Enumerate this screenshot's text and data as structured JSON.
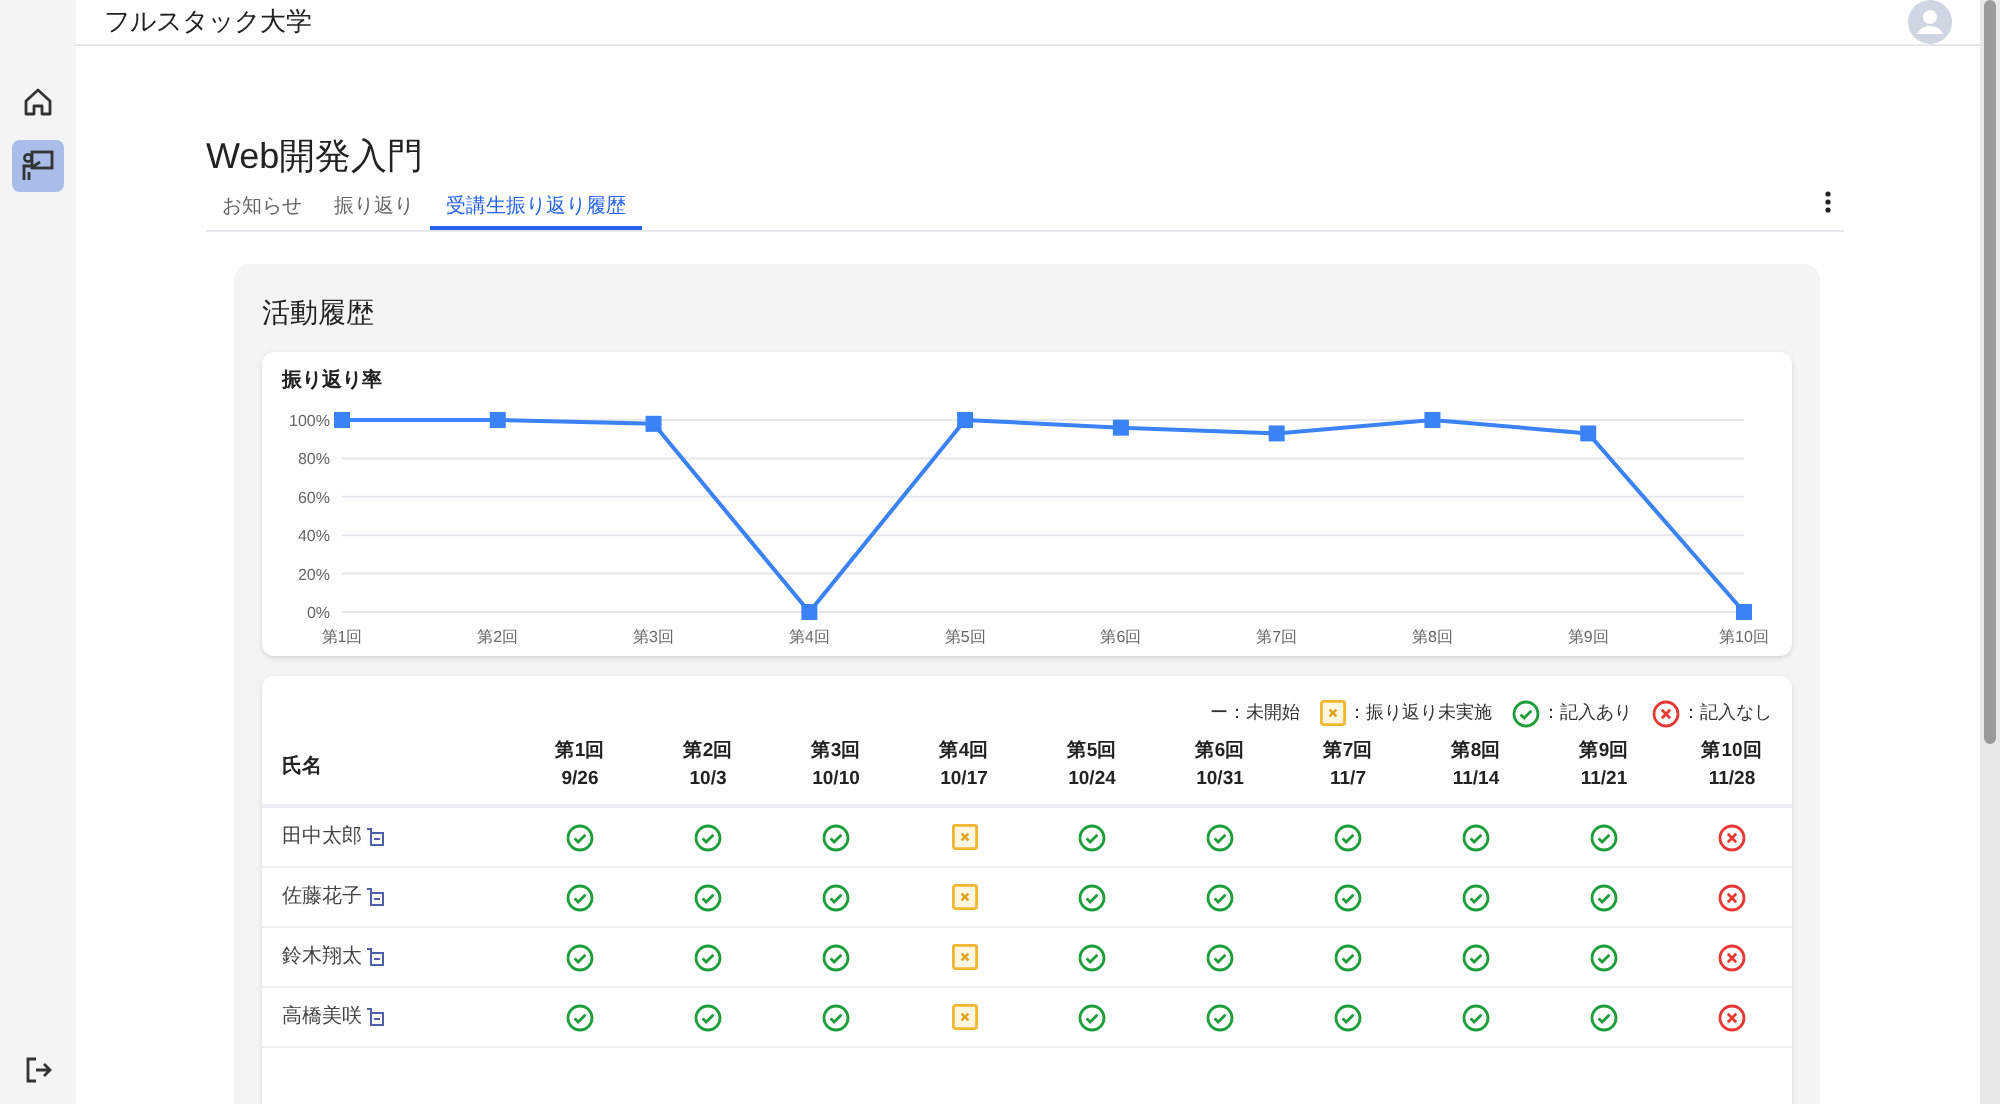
{
  "app": {
    "title": "フルスタック大学"
  },
  "sidebar": {
    "items": [
      {
        "kind": "home",
        "selected": false
      },
      {
        "kind": "teacher",
        "selected": true
      }
    ]
  },
  "course": {
    "title": "Web開発入門"
  },
  "tabs": [
    {
      "label": "お知らせ",
      "selected": false
    },
    {
      "label": "振り返り",
      "selected": false
    },
    {
      "label": "受講生振り返り履歴",
      "selected": true
    }
  ],
  "activity": {
    "title": "活動履歴",
    "chart": {
      "chart_data": {
        "type": "line",
        "title": "振り返り率",
        "grid": true,
        "categories": [
          "第1回",
          "第2回",
          "第3回",
          "第4回",
          "第5回",
          "第6回",
          "第7回",
          "第8回",
          "第9回",
          "第10回"
        ],
        "series": [
          {
            "color": "#3b82f6",
            "marker": "square",
            "values": [
              100,
              100,
              98,
              0,
              100,
              96,
              93,
              100,
              93,
              0
            ]
          }
        ],
        "ylim": [
          0,
          100
        ],
        "yticks": [
          {
            "value": 0,
            "label": "0%"
          },
          {
            "value": 20,
            "label": "20%"
          },
          {
            "value": 40,
            "label": "40%"
          },
          {
            "value": 60,
            "label": "60%"
          },
          {
            "value": 80,
            "label": "80%"
          },
          {
            "value": 100,
            "label": "100%"
          }
        ]
      }
    },
    "legend": [
      {
        "kind": "not_started",
        "label": "ー：未開始"
      },
      {
        "kind": "pending",
        "label": "：振り返り未実施"
      },
      {
        "kind": "done",
        "label": "：記入あり"
      },
      {
        "kind": "missing",
        "label": "：記入なし"
      }
    ],
    "table": {
      "name_header": "氏名",
      "columns": [
        {
          "round": "第1回",
          "date": "9/26"
        },
        {
          "round": "第2回",
          "date": "10/3"
        },
        {
          "round": "第3回",
          "date": "10/10"
        },
        {
          "round": "第4回",
          "date": "10/17"
        },
        {
          "round": "第5回",
          "date": "10/24"
        },
        {
          "round": "第6回",
          "date": "10/31"
        },
        {
          "round": "第7回",
          "date": "11/7"
        },
        {
          "round": "第8回",
          "date": "11/14"
        },
        {
          "round": "第9回",
          "date": "11/21"
        },
        {
          "round": "第10回",
          "date": "11/28"
        }
      ],
      "rows": [
        {
          "name": "田中太郎",
          "cells": [
            {
              "kind": "done"
            },
            {
              "kind": "done"
            },
            {
              "kind": "done"
            },
            {
              "kind": "pending"
            },
            {
              "kind": "done"
            },
            {
              "kind": "done"
            },
            {
              "kind": "done"
            },
            {
              "kind": "done"
            },
            {
              "kind": "done"
            },
            {
              "kind": "missing"
            }
          ]
        },
        {
          "name": "佐藤花子",
          "cells": [
            {
              "kind": "done"
            },
            {
              "kind": "done"
            },
            {
              "kind": "done"
            },
            {
              "kind": "pending"
            },
            {
              "kind": "done"
            },
            {
              "kind": "done"
            },
            {
              "kind": "done"
            },
            {
              "kind": "done"
            },
            {
              "kind": "done"
            },
            {
              "kind": "missing"
            }
          ]
        },
        {
          "name": "鈴木翔太",
          "cells": [
            {
              "kind": "done"
            },
            {
              "kind": "done"
            },
            {
              "kind": "done"
            },
            {
              "kind": "pending"
            },
            {
              "kind": "done"
            },
            {
              "kind": "done"
            },
            {
              "kind": "done"
            },
            {
              "kind": "done"
            },
            {
              "kind": "done"
            },
            {
              "kind": "missing"
            }
          ]
        },
        {
          "name": "高橋美咲",
          "cells": [
            {
              "kind": "done"
            },
            {
              "kind": "done"
            },
            {
              "kind": "done"
            },
            {
              "kind": "pending"
            },
            {
              "kind": "done"
            },
            {
              "kind": "done"
            },
            {
              "kind": "done"
            },
            {
              "kind": "done"
            },
            {
              "kind": "done"
            },
            {
              "kind": "missing"
            }
          ]
        }
      ]
    }
  }
}
